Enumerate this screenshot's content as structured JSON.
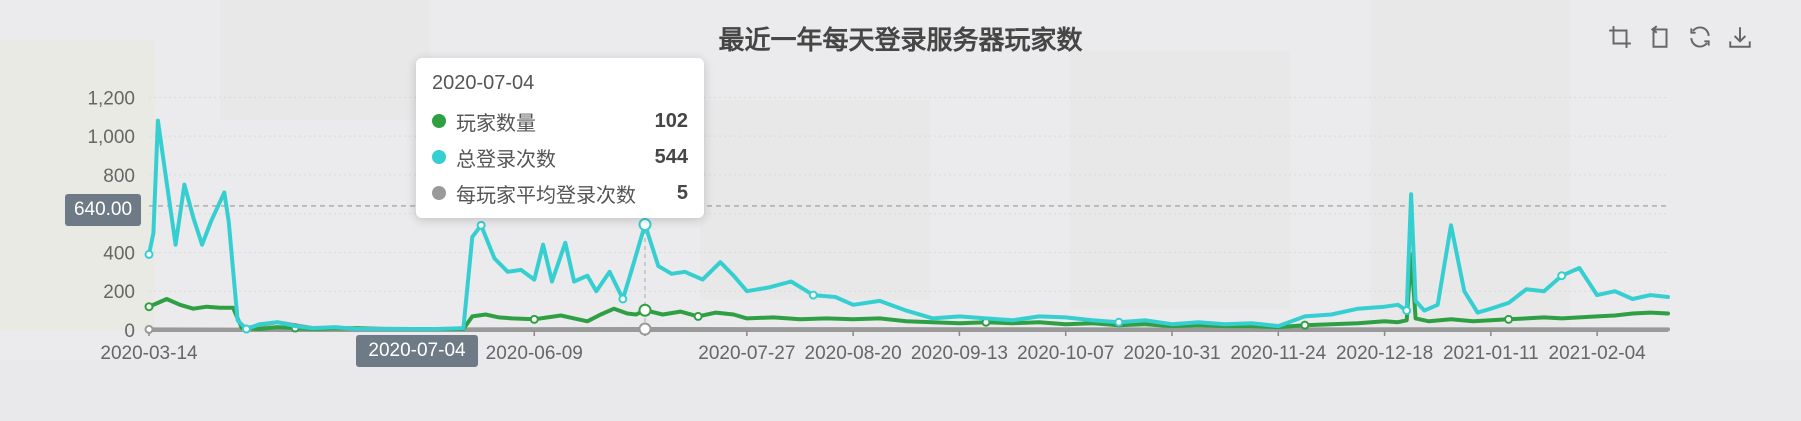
{
  "toolbox": {
    "icons": [
      "zoom-icon",
      "zoom-reset-icon",
      "restore-icon",
      "save-image-icon"
    ]
  },
  "tooltip": {
    "date": "2020-07-04",
    "rows": [
      {
        "name": "玩家数量",
        "value": "102",
        "color": "#2ea043"
      },
      {
        "name": "总登录次数",
        "value": "544",
        "color": "#36cfd1"
      },
      {
        "name": "每玩家平均登录次数",
        "value": "5",
        "color": "#9a9a9a"
      }
    ]
  },
  "mark_line": {
    "label": "640.00",
    "value": 640
  },
  "axis_pointer": {
    "label": "2020-07-04"
  },
  "chart_data": {
    "type": "line",
    "title": "最近一年每天登录服务器玩家数",
    "x_range": [
      "2020-03-14",
      "2021-02-20"
    ],
    "ylim": [
      0,
      1300
    ],
    "y_ticks": [
      "0",
      "200",
      "400",
      "600",
      "800",
      "1,000",
      "1,200"
    ],
    "x_ticks": [
      "2020-03-14",
      "2020-06-09",
      "2020-07-04",
      "2020-07-27",
      "2020-08-20",
      "2020-09-13",
      "2020-10-07",
      "2020-10-31",
      "2020-11-24",
      "2020-12-18",
      "2021-01-11",
      "2021-02-04"
    ],
    "mark_line_value": 640,
    "series": [
      {
        "name": "玩家数量",
        "color": "#2ea043",
        "points": [
          [
            "2020-03-14",
            120
          ],
          [
            "2020-03-16",
            140
          ],
          [
            "2020-03-18",
            160
          ],
          [
            "2020-03-21",
            130
          ],
          [
            "2020-03-24",
            110
          ],
          [
            "2020-03-27",
            120
          ],
          [
            "2020-03-30",
            115
          ],
          [
            "2020-04-02",
            115
          ],
          [
            "2020-04-03",
            60
          ],
          [
            "2020-04-04",
            10
          ],
          [
            "2020-04-08",
            5
          ],
          [
            "2020-04-12",
            15
          ],
          [
            "2020-04-16",
            10
          ],
          [
            "2020-04-20",
            5
          ],
          [
            "2020-04-25",
            8
          ],
          [
            "2020-04-30",
            10
          ],
          [
            "2020-05-06",
            5
          ],
          [
            "2020-05-12",
            5
          ],
          [
            "2020-05-18",
            5
          ],
          [
            "2020-05-24",
            5
          ],
          [
            "2020-05-26",
            70
          ],
          [
            "2020-05-29",
            80
          ],
          [
            "2020-06-01",
            65
          ],
          [
            "2020-06-04",
            60
          ],
          [
            "2020-06-09",
            55
          ],
          [
            "2020-06-12",
            65
          ],
          [
            "2020-06-15",
            75
          ],
          [
            "2020-06-18",
            60
          ],
          [
            "2020-06-21",
            45
          ],
          [
            "2020-06-24",
            80
          ],
          [
            "2020-06-27",
            110
          ],
          [
            "2020-06-30",
            85
          ],
          [
            "2020-07-02",
            80
          ],
          [
            "2020-07-04",
            102
          ],
          [
            "2020-07-08",
            80
          ],
          [
            "2020-07-12",
            95
          ],
          [
            "2020-07-16",
            70
          ],
          [
            "2020-07-20",
            90
          ],
          [
            "2020-07-24",
            80
          ],
          [
            "2020-07-27",
            60
          ],
          [
            "2020-08-02",
            65
          ],
          [
            "2020-08-08",
            55
          ],
          [
            "2020-08-14",
            60
          ],
          [
            "2020-08-20",
            55
          ],
          [
            "2020-08-26",
            60
          ],
          [
            "2020-09-01",
            45
          ],
          [
            "2020-09-07",
            40
          ],
          [
            "2020-09-13",
            35
          ],
          [
            "2020-09-19",
            40
          ],
          [
            "2020-09-25",
            35
          ],
          [
            "2020-10-01",
            40
          ],
          [
            "2020-10-07",
            30
          ],
          [
            "2020-10-13",
            35
          ],
          [
            "2020-10-19",
            25
          ],
          [
            "2020-10-25",
            30
          ],
          [
            "2020-10-31",
            20
          ],
          [
            "2020-11-06",
            25
          ],
          [
            "2020-11-12",
            20
          ],
          [
            "2020-11-18",
            20
          ],
          [
            "2020-11-24",
            15
          ],
          [
            "2020-11-30",
            25
          ],
          [
            "2020-12-06",
            30
          ],
          [
            "2020-12-12",
            35
          ],
          [
            "2020-12-18",
            45
          ],
          [
            "2020-12-21",
            40
          ],
          [
            "2020-12-23",
            50
          ],
          [
            "2020-12-24",
            390
          ],
          [
            "2020-12-25",
            60
          ],
          [
            "2020-12-28",
            45
          ],
          [
            "2021-01-02",
            55
          ],
          [
            "2021-01-07",
            45
          ],
          [
            "2021-01-11",
            50
          ],
          [
            "2021-01-15",
            55
          ],
          [
            "2021-01-19",
            60
          ],
          [
            "2021-01-23",
            65
          ],
          [
            "2021-01-27",
            60
          ],
          [
            "2021-01-31",
            65
          ],
          [
            "2021-02-04",
            70
          ],
          [
            "2021-02-08",
            75
          ],
          [
            "2021-02-12",
            85
          ],
          [
            "2021-02-16",
            90
          ],
          [
            "2021-02-20",
            85
          ]
        ]
      },
      {
        "name": "总登录次数",
        "color": "#36cfd1",
        "points": [
          [
            "2020-03-14",
            390
          ],
          [
            "2020-03-15",
            500
          ],
          [
            "2020-03-16",
            1080
          ],
          [
            "2020-03-18",
            760
          ],
          [
            "2020-03-20",
            440
          ],
          [
            "2020-03-22",
            750
          ],
          [
            "2020-03-24",
            580
          ],
          [
            "2020-03-26",
            440
          ],
          [
            "2020-03-28",
            560
          ],
          [
            "2020-03-31",
            710
          ],
          [
            "2020-04-01",
            560
          ],
          [
            "2020-04-03",
            50
          ],
          [
            "2020-04-05",
            5
          ],
          [
            "2020-04-08",
            30
          ],
          [
            "2020-04-12",
            40
          ],
          [
            "2020-04-16",
            20
          ],
          [
            "2020-04-20",
            10
          ],
          [
            "2020-04-25",
            15
          ],
          [
            "2020-04-30",
            5
          ],
          [
            "2020-05-06",
            5
          ],
          [
            "2020-05-12",
            5
          ],
          [
            "2020-05-18",
            5
          ],
          [
            "2020-05-24",
            10
          ],
          [
            "2020-05-26",
            480
          ],
          [
            "2020-05-28",
            540
          ],
          [
            "2020-05-31",
            370
          ],
          [
            "2020-06-03",
            300
          ],
          [
            "2020-06-06",
            310
          ],
          [
            "2020-06-09",
            260
          ],
          [
            "2020-06-11",
            440
          ],
          [
            "2020-06-13",
            250
          ],
          [
            "2020-06-16",
            450
          ],
          [
            "2020-06-18",
            250
          ],
          [
            "2020-06-21",
            280
          ],
          [
            "2020-06-23",
            200
          ],
          [
            "2020-06-26",
            300
          ],
          [
            "2020-06-29",
            160
          ],
          [
            "2020-07-01",
            310
          ],
          [
            "2020-07-04",
            544
          ],
          [
            "2020-07-07",
            330
          ],
          [
            "2020-07-10",
            290
          ],
          [
            "2020-07-13",
            300
          ],
          [
            "2020-07-17",
            260
          ],
          [
            "2020-07-21",
            350
          ],
          [
            "2020-07-24",
            280
          ],
          [
            "2020-07-27",
            200
          ],
          [
            "2020-08-01",
            220
          ],
          [
            "2020-08-06",
            250
          ],
          [
            "2020-08-11",
            180
          ],
          [
            "2020-08-16",
            170
          ],
          [
            "2020-08-20",
            130
          ],
          [
            "2020-08-26",
            150
          ],
          [
            "2020-09-01",
            100
          ],
          [
            "2020-09-07",
            60
          ],
          [
            "2020-09-13",
            70
          ],
          [
            "2020-09-19",
            60
          ],
          [
            "2020-09-25",
            50
          ],
          [
            "2020-10-01",
            70
          ],
          [
            "2020-10-07",
            65
          ],
          [
            "2020-10-13",
            50
          ],
          [
            "2020-10-19",
            40
          ],
          [
            "2020-10-25",
            50
          ],
          [
            "2020-10-31",
            30
          ],
          [
            "2020-11-06",
            40
          ],
          [
            "2020-11-12",
            30
          ],
          [
            "2020-11-18",
            35
          ],
          [
            "2020-11-24",
            20
          ],
          [
            "2020-11-30",
            70
          ],
          [
            "2020-12-06",
            80
          ],
          [
            "2020-12-12",
            110
          ],
          [
            "2020-12-18",
            120
          ],
          [
            "2020-12-21",
            130
          ],
          [
            "2020-12-23",
            100
          ],
          [
            "2020-12-24",
            700
          ],
          [
            "2020-12-25",
            150
          ],
          [
            "2020-12-27",
            100
          ],
          [
            "2020-12-30",
            130
          ],
          [
            "2021-01-02",
            540
          ],
          [
            "2021-01-05",
            200
          ],
          [
            "2021-01-08",
            90
          ],
          [
            "2021-01-11",
            110
          ],
          [
            "2021-01-15",
            140
          ],
          [
            "2021-01-19",
            210
          ],
          [
            "2021-01-23",
            200
          ],
          [
            "2021-01-27",
            280
          ],
          [
            "2021-01-31",
            320
          ],
          [
            "2021-02-04",
            180
          ],
          [
            "2021-02-08",
            200
          ],
          [
            "2021-02-12",
            160
          ],
          [
            "2021-02-16",
            180
          ],
          [
            "2021-02-20",
            170
          ]
        ]
      },
      {
        "name": "每玩家平均登录次数",
        "color": "#9a9a9a",
        "points": [
          [
            "2020-03-14",
            3
          ],
          [
            "2020-04-03",
            2
          ],
          [
            "2020-04-12",
            40
          ],
          [
            "2020-04-20",
            10
          ],
          [
            "2020-05-24",
            3
          ],
          [
            "2020-07-04",
            5
          ],
          [
            "2020-09-13",
            4
          ],
          [
            "2020-11-24",
            3
          ],
          [
            "2021-01-11",
            4
          ],
          [
            "2021-02-20",
            3
          ]
        ]
      }
    ]
  }
}
